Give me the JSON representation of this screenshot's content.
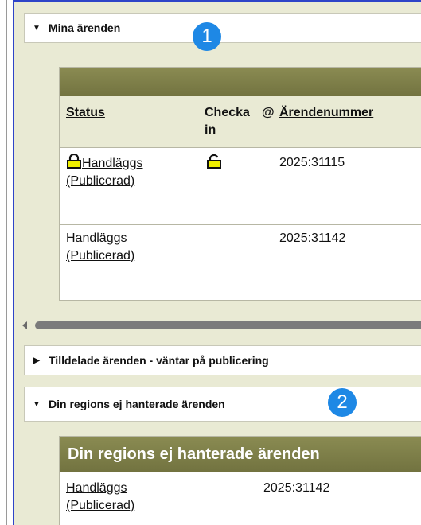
{
  "section1": {
    "title": "Mina ärenden",
    "badge": "1",
    "table": {
      "headers": {
        "status": "Status",
        "checkin": "Checka in",
        "at": "@",
        "number": "Ärendenummer"
      },
      "rows": [
        {
          "status_line1": "Handläggs",
          "status_line2": "(Publicerad)",
          "number": "2025:31115",
          "locked": true
        },
        {
          "status_line1": "Handläggs",
          "status_line2": "(Publicerad)",
          "number": "2025:31142",
          "locked": false
        }
      ]
    }
  },
  "section2": {
    "title": "Tilldelade ärenden - väntar på publicering"
  },
  "section3": {
    "title": "Din regions ej hanterade ärenden",
    "badge": "2",
    "panel_title": "Din regions ej hanterade ärenden",
    "rows": [
      {
        "status_line1": "Handläggs",
        "status_line2": "(Publicerad)",
        "number": "2025:31142"
      }
    ]
  },
  "icons": {
    "expanded": "triangle-down-icon",
    "collapsed": "triangle-right-icon",
    "lock": "padlock-icon",
    "scroll_left": "scroll-left-arrow-icon"
  },
  "colors": {
    "badge": "#1e88e5",
    "olive": "#7f8048",
    "lock_fill": "#f0f000",
    "frame": "#2e44c8"
  }
}
